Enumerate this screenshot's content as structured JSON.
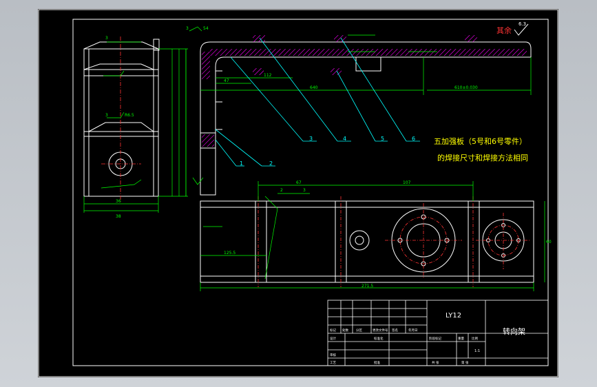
{
  "notes": {
    "line1": "五加强板（5号和6号零件）",
    "line2": "的焊接尺寸和焊接方法相同"
  },
  "roughness": {
    "label": "其余",
    "value": "6.3"
  },
  "callouts": [
    "1",
    "2",
    "3",
    "4",
    "5",
    "6"
  ],
  "dims": {
    "top_weld": "3",
    "top_weld_len": "54",
    "side_w": "36",
    "side_w2": "38",
    "h1": "112",
    "h2": "47",
    "len_640": "640",
    "len_bot": "610±0.030",
    "bottom_67": "67",
    "bottom_107": "107",
    "bottom_total": "271.5",
    "bottom_125": "125.5",
    "bottom_h": "60",
    "weld_a": "2",
    "weld_b": "3",
    "ref_3": "3",
    "ref_865": "R6.5"
  },
  "title_block": {
    "material": "LY12",
    "part_name": "转向架",
    "scale": "1:1",
    "labels": [
      "标记",
      "处数",
      "分区",
      "更改文件号",
      "签名",
      "年月日",
      "设计",
      "标准化",
      "阶段标记",
      "重量",
      "比例",
      "审核",
      "工艺",
      "批准",
      "共 张",
      "第 张"
    ]
  },
  "colors": {
    "sheet": "#000000",
    "border": "#ffffff",
    "part": "#ffffff",
    "dimension": "#00ff00",
    "leader": "#00ffff",
    "hatch": "#ff00ff",
    "centerline": "#ff3333",
    "note": "#ffff00"
  }
}
